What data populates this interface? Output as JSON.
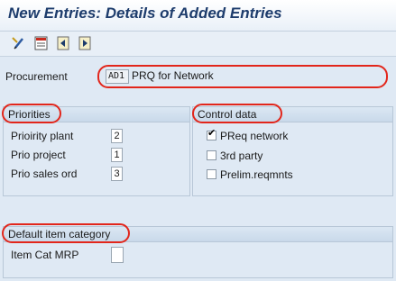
{
  "header": {
    "title": "New Entries: Details of Added Entries"
  },
  "toolbar": {
    "buttons": [
      {
        "icon": "edit-pencil-icon"
      },
      {
        "icon": "list-view-icon"
      },
      {
        "icon": "previous-entry-icon"
      },
      {
        "icon": "next-entry-icon"
      }
    ]
  },
  "procurement": {
    "label": "Procurement",
    "code": "AD1",
    "value": "PRQ for Network"
  },
  "priorities": {
    "title": "Priorities",
    "rows": [
      {
        "label": "Prioirity plant",
        "value": "2"
      },
      {
        "label": "Prio project",
        "value": "1"
      },
      {
        "label": "Prio sales ord",
        "value": "3"
      }
    ]
  },
  "control_data": {
    "title": "Control data",
    "items": [
      {
        "label": "PReq network",
        "checked": true
      },
      {
        "label": "3rd party",
        "checked": false
      },
      {
        "label": "Prelim.reqmnts",
        "checked": false
      }
    ]
  },
  "default_item_category": {
    "title": "Default item category",
    "label": "Item Cat MRP",
    "value": ""
  },
  "annotation_color": "#e2261b"
}
